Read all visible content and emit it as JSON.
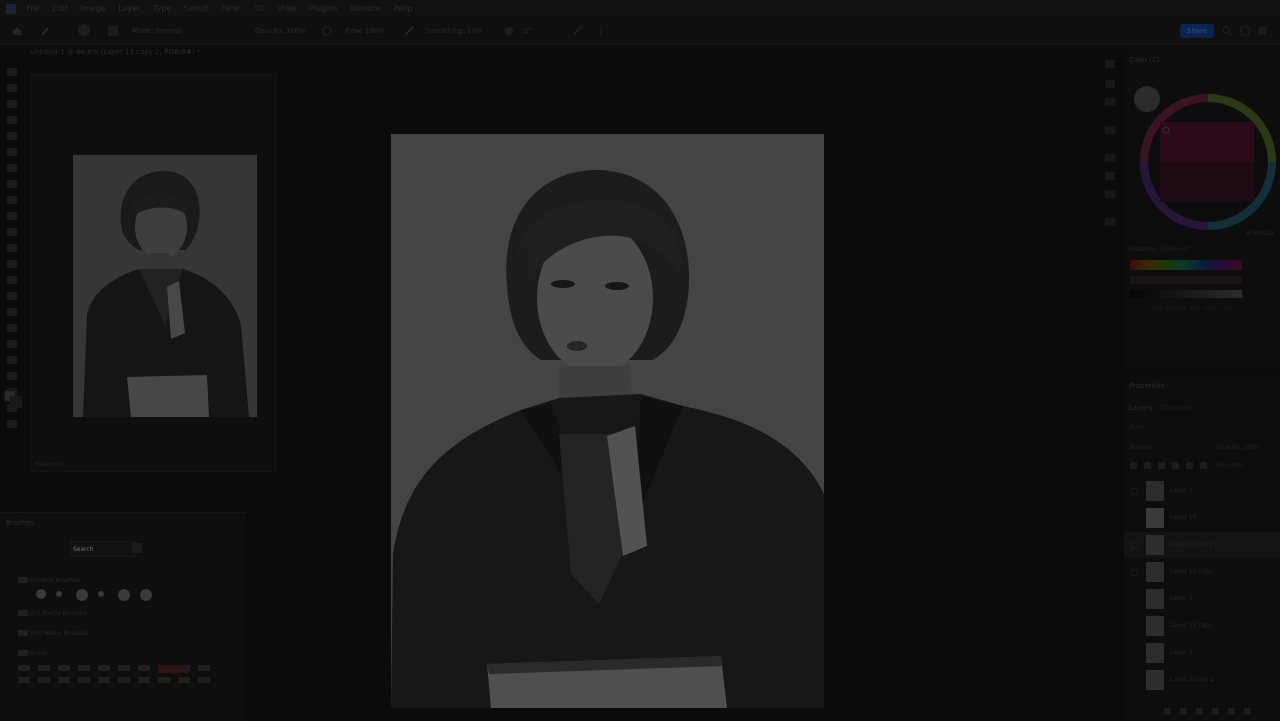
{
  "menubar": {
    "items": [
      "File",
      "Edit",
      "Image",
      "Layer",
      "Type",
      "Select",
      "Filter",
      "3D",
      "View",
      "Plugins",
      "Window",
      "Help"
    ]
  },
  "options": {
    "mode_label": "Mode: Normal",
    "opacity_label": "Opacity: 100%",
    "flow_label": "Flow: 100%",
    "smoothing_label": "Smoothing: 10%",
    "angle_label": "0°",
    "share_label": "Share"
  },
  "document": {
    "tab_title": "Untitled-1 @ 66.6% (Layer 13 copy 2, RGB/8#) *"
  },
  "reference": {
    "name_label": "Reference"
  },
  "brushes": {
    "title": "Brushes",
    "search_placeholder": "Search",
    "groups": [
      "General Brushes",
      "Dry Media Brushes",
      "Wet Media Brushes",
      "Brush"
    ]
  },
  "color": {
    "title": "Color (C)",
    "hex_value": "#2b0a1a",
    "swatches_tab": "Swatches",
    "gradients_tab": "Gradients",
    "readout": "100 · 0%  140 · 120 · 255%  ·  10%"
  },
  "layers": {
    "title": "Properties",
    "tabs": [
      "Layers",
      "Channels"
    ],
    "kind_label": "Kind",
    "blend_mode": "Normal",
    "opacity_label": "Opacity: 100%",
    "fill_label": "Fill: 100%",
    "items": [
      {
        "name": "Layer 1",
        "visible": true
      },
      {
        "name": "Layer 19",
        "visible": false
      },
      {
        "name": "Layer 13 copy 2",
        "visible": true
      },
      {
        "name": "Layer 13 copy",
        "visible": true
      },
      {
        "name": "Layer 2",
        "visible": false
      },
      {
        "name": "Layer 13 copy",
        "visible": false
      },
      {
        "name": "Layer 5",
        "visible": false
      },
      {
        "name": "Layer 1 copy 2",
        "visible": false
      }
    ]
  },
  "colors": {
    "accent": "#0c2550",
    "background": "#0b0b0b",
    "canvas_bg": "#444444"
  }
}
